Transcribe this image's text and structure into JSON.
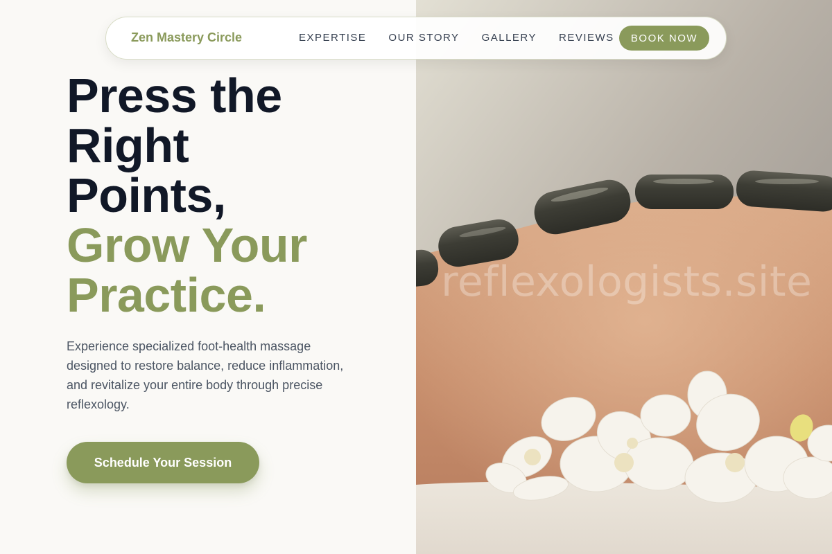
{
  "nav": {
    "brand": "Zen Mastery Circle",
    "links": [
      "EXPERTISE",
      "OUR STORY",
      "GALLERY",
      "REVIEWS"
    ],
    "cta_label": "BOOK NOW"
  },
  "hero": {
    "headline_dark": [
      "Press the",
      "Right",
      "Points,"
    ],
    "headline_accent": [
      "Grow Your",
      "Practice."
    ],
    "description_lines": [
      "Experience specialized foot-health massage",
      "designed to restore balance, reduce inflammation,",
      "and revitalize your entire body through precise",
      "reflexology."
    ],
    "cta_label": "Schedule Your Session"
  },
  "image": {
    "watermark": "reflexologists.site"
  },
  "colors": {
    "accent": "#8a9a5b",
    "heading": "#111827",
    "body_text": "#4b5563",
    "background": "#faf9f6"
  }
}
